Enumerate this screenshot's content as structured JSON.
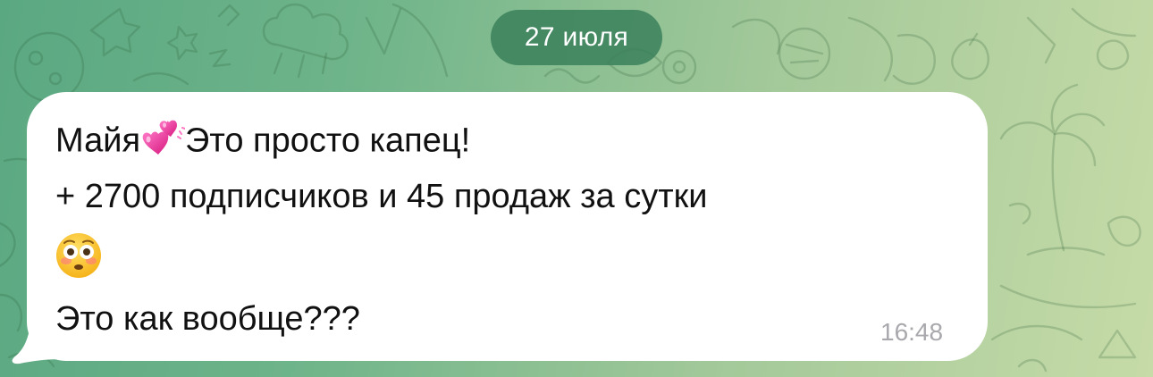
{
  "date_separator": "27 июля",
  "message": {
    "line1_name": "Майя",
    "line1_emoji": "two-hearts-emoji",
    "line1_rest": "Это просто капец!",
    "line2": "+ 2700 подписчиков и 45 продаж за сутки",
    "line3_emoji": "flushed-face-emoji",
    "line4": "Это как вообще???",
    "time": "16:48"
  },
  "colors": {
    "background_gradient_start": "#5aa882",
    "background_gradient_end": "#c6dba7",
    "date_pill": "#3a805a",
    "bubble": "#ffffff",
    "text": "#111111",
    "timestamp": "#a9a9ad"
  }
}
